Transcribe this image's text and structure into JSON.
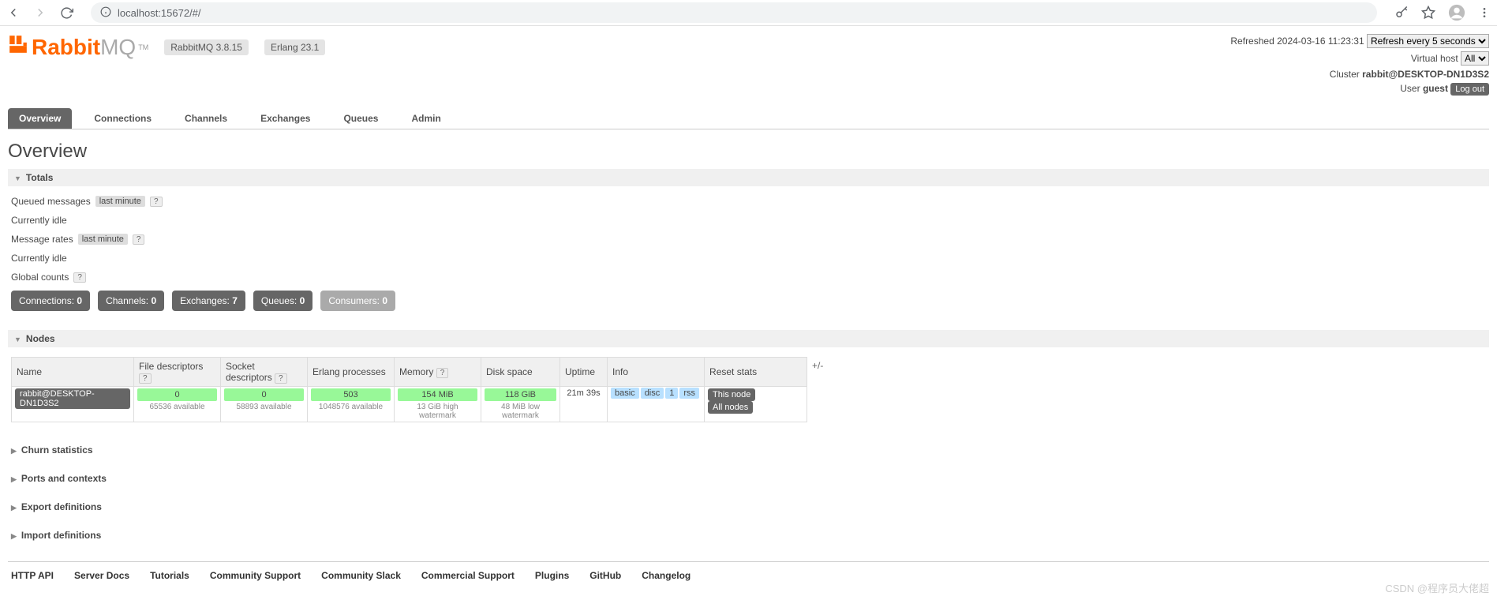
{
  "browser": {
    "url": "localhost:15672/#/"
  },
  "header": {
    "logo_rabbit": "Rabbit",
    "logo_mq": "MQ",
    "logo_tm": "TM",
    "version": "RabbitMQ 3.8.15",
    "erlang": "Erlang 23.1",
    "refreshed_label": "Refreshed",
    "refreshed_time": "2024-03-16 11:23:31",
    "refresh_select": "Refresh every 5 seconds",
    "vhost_label": "Virtual host",
    "vhost_value": "All",
    "cluster_label": "Cluster",
    "cluster_name": "rabbit@DESKTOP-DN1D3S2",
    "user_label": "User",
    "user_name": "guest",
    "logout": "Log out"
  },
  "tabs": [
    "Overview",
    "Connections",
    "Channels",
    "Exchanges",
    "Queues",
    "Admin"
  ],
  "page_title": "Overview",
  "totals": {
    "title": "Totals",
    "queued_label": "Queued messages",
    "last_minute": "last minute",
    "idle1": "Currently idle",
    "rates_label": "Message rates",
    "idle2": "Currently idle",
    "global_counts": "Global counts"
  },
  "counts": {
    "connections_label": "Connections:",
    "connections_val": "0",
    "channels_label": "Channels:",
    "channels_val": "0",
    "exchanges_label": "Exchanges:",
    "exchanges_val": "7",
    "queues_label": "Queues:",
    "queues_val": "0",
    "consumers_label": "Consumers:",
    "consumers_val": "0"
  },
  "nodes": {
    "title": "Nodes",
    "plus_minus": "+/-",
    "headers": {
      "name": "Name",
      "fd": "File descriptors",
      "sd": "Socket descriptors",
      "ep": "Erlang processes",
      "mem": "Memory",
      "disk": "Disk space",
      "uptime": "Uptime",
      "info": "Info",
      "reset": "Reset stats"
    },
    "row": {
      "name": "rabbit@DESKTOP-DN1D3S2",
      "fd_val": "0",
      "fd_sub": "65536 available",
      "sd_val": "0",
      "sd_sub": "58893 available",
      "ep_val": "503",
      "ep_sub": "1048576 available",
      "mem_val": "154 MiB",
      "mem_sub": "13 GiB high watermark",
      "disk_val": "118 GiB",
      "disk_sub": "48 MiB low watermark",
      "uptime": "21m 39s",
      "info_basic": "basic",
      "info_disc": "disc",
      "info_1": "1",
      "info_rss": "rss",
      "reset_this": "This node",
      "reset_all": "All nodes"
    }
  },
  "collapsed": {
    "churn": "Churn statistics",
    "ports": "Ports and contexts",
    "export": "Export definitions",
    "import": "Import definitions"
  },
  "footer": {
    "http_api": "HTTP API",
    "server_docs": "Server Docs",
    "tutorials": "Tutorials",
    "community_support": "Community Support",
    "community_slack": "Community Slack",
    "commercial_support": "Commercial Support",
    "plugins": "Plugins",
    "github": "GitHub",
    "changelog": "Changelog"
  },
  "watermark": "CSDN @程序员大佬超"
}
